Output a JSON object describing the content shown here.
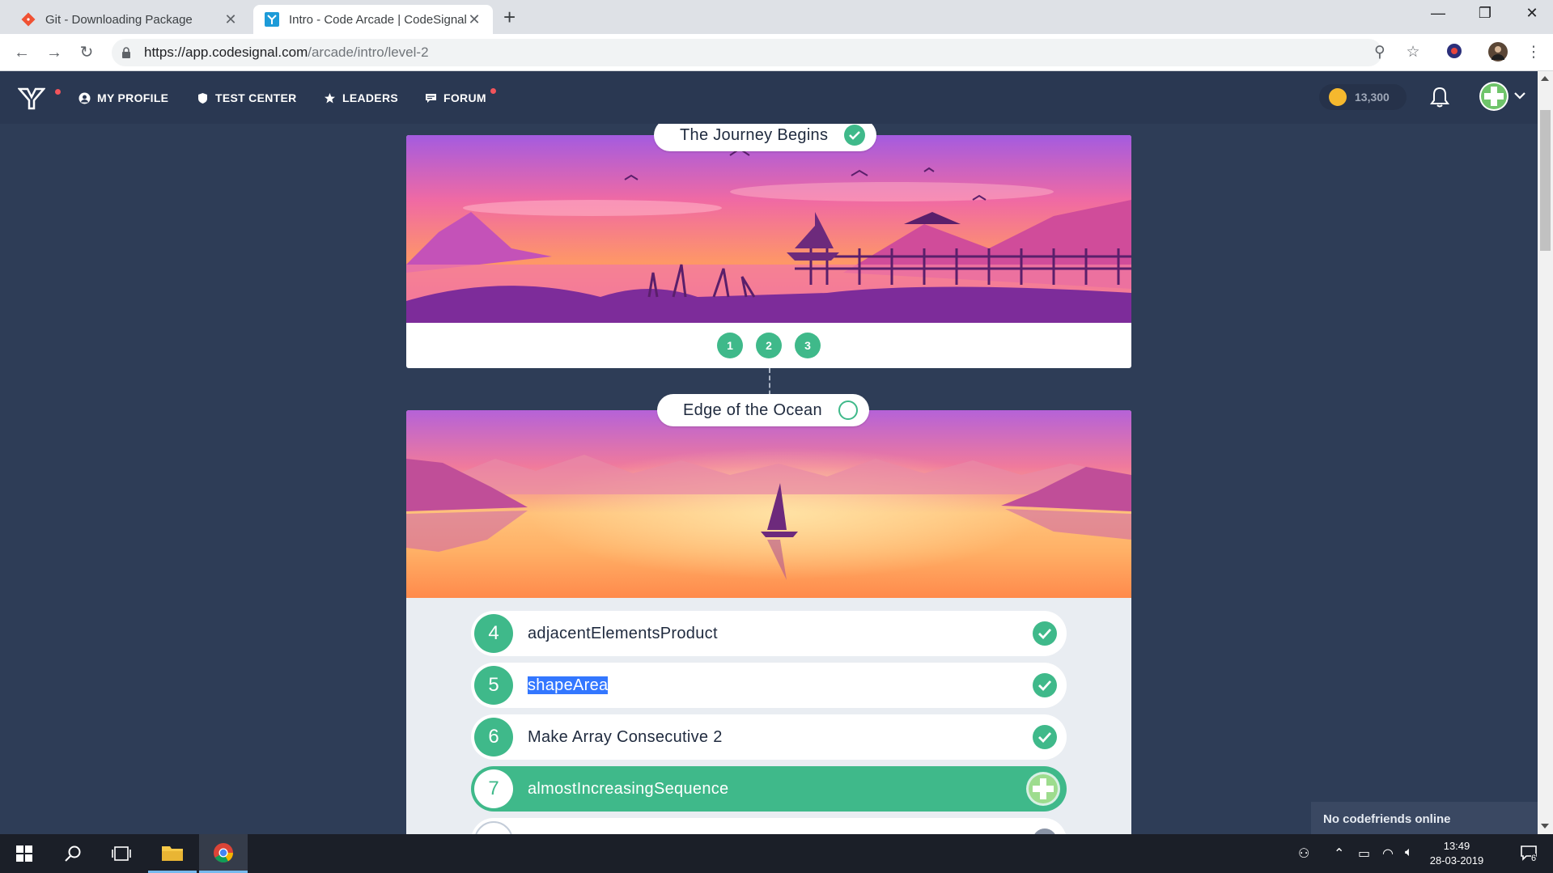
{
  "browser": {
    "tabs": [
      {
        "title": "Git - Downloading Package",
        "active": false
      },
      {
        "title": "Intro - Code Arcade | CodeSignal",
        "active": true
      }
    ],
    "url_host": "https://app.codesignal.com",
    "url_path": "/arcade/intro/level-2"
  },
  "nav": {
    "links": [
      "MY PROFILE",
      "TEST CENTER",
      "LEADERS",
      "FORUM"
    ],
    "coins": "13,300"
  },
  "levels": [
    {
      "title": "The Journey Begins",
      "completed": true,
      "dots": [
        "1",
        "2",
        "3"
      ]
    },
    {
      "title": "Edge of the Ocean",
      "completed": false
    }
  ],
  "tasks": [
    {
      "num": "4",
      "name": "adjacentElementsProduct",
      "state": "done"
    },
    {
      "num": "5",
      "name": "shapeArea",
      "state": "done",
      "selected": true
    },
    {
      "num": "6",
      "name": "Make Array Consecutive 2",
      "state": "done"
    },
    {
      "num": "7",
      "name": "almostIncreasingSequence",
      "state": "current"
    }
  ],
  "chat": {
    "label": "No codefriends online"
  },
  "taskbar": {
    "time": "13:49",
    "date": "28-03-2019",
    "notifications": "6"
  },
  "colors": {
    "accent": "#3fb98a",
    "nav_bg": "#2a3852",
    "page_bg": "#2e3d57",
    "selection": "#3377ff"
  }
}
